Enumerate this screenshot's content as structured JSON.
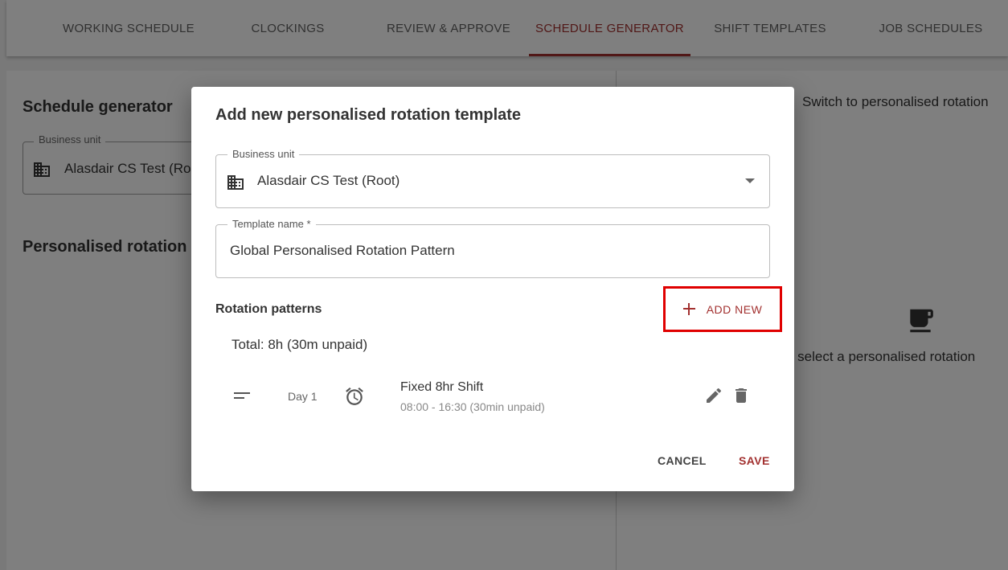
{
  "tabs": [
    {
      "label": "WORKING SCHEDULE",
      "active": false
    },
    {
      "label": "CLOCKINGS",
      "active": false
    },
    {
      "label": "REVIEW & APPROVE",
      "active": false
    },
    {
      "label": "SCHEDULE GENERATOR",
      "active": true
    },
    {
      "label": "SHIFT TEMPLATES",
      "active": false
    },
    {
      "label": "JOB SCHEDULES",
      "active": false
    }
  ],
  "background": {
    "title": "Schedule generator",
    "business_unit_label": "Business unit",
    "business_unit_value": "Alasdair CS Test (Ro",
    "section_title": "Personalised rotation",
    "switch_label": "Switch to personalised rotation",
    "empty_message": "ase select a personalised rotation"
  },
  "dialog": {
    "title": "Add new personalised rotation template",
    "business_unit": {
      "label": "Business unit",
      "value": "Alasdair CS Test (Root)"
    },
    "template_name": {
      "label": "Template name *",
      "value": "Global Personalised Rotation Pattern"
    },
    "rotation_patterns_label": "Rotation patterns",
    "add_new_label": "ADD NEW",
    "total": "Total: 8h (30m unpaid)",
    "patterns": [
      {
        "day": "Day 1",
        "name": "Fixed 8hr Shift",
        "time": "08:00 - 16:30 (30min unpaid)"
      }
    ],
    "cancel_label": "CANCEL",
    "save_label": "SAVE"
  },
  "colors": {
    "accent": "#a2302f",
    "highlight": "#e00000",
    "overlay": "rgba(0,0,0,0.5)"
  }
}
